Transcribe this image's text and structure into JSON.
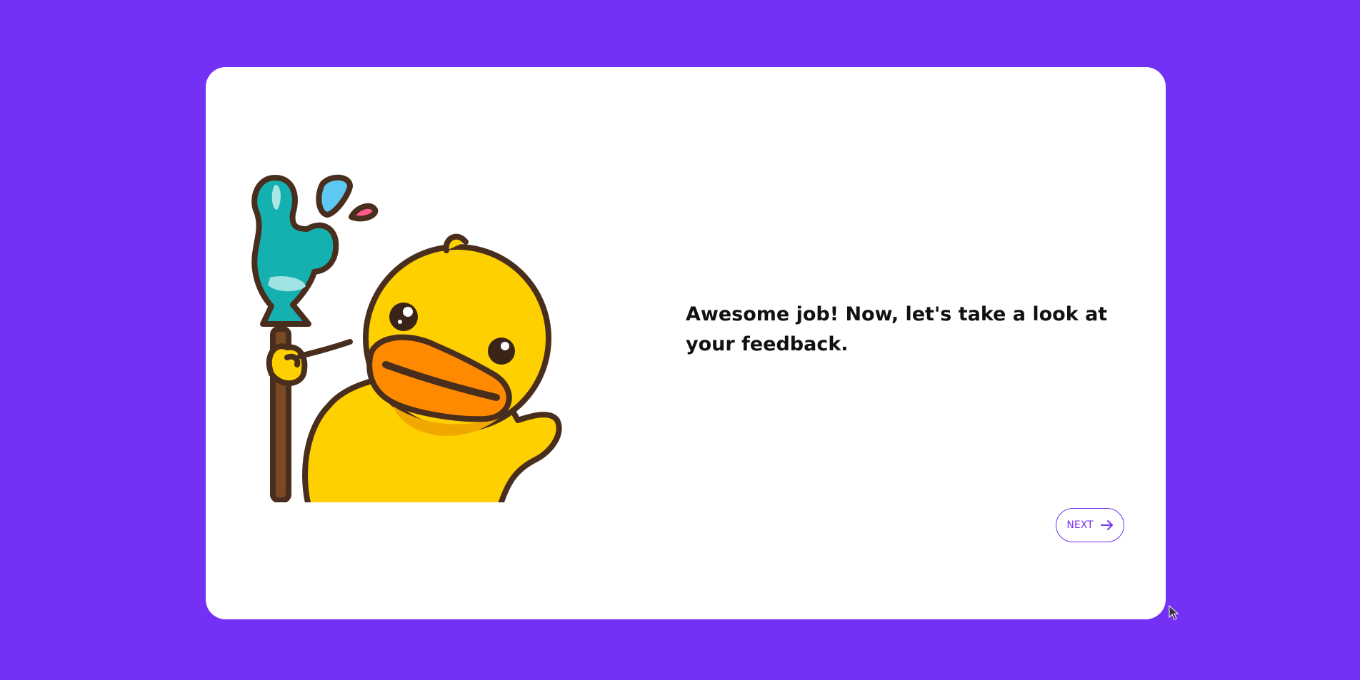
{
  "colors": {
    "background": "#7431f5",
    "card": "#ffffff",
    "accent": "#7431f5",
    "text": "#111111"
  },
  "main": {
    "illustration": "duck-mascot-holding-foam-finger",
    "message": "Awesome job! Now, let's take a look at your feedback.",
    "next_button": {
      "label": "NEXT",
      "icon": "arrow-right-icon"
    }
  }
}
